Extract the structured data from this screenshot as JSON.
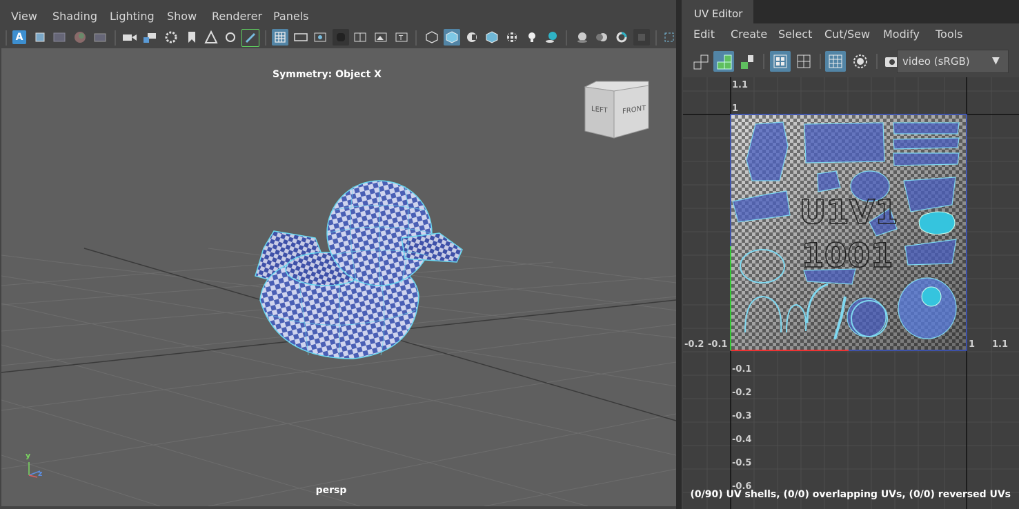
{
  "viewport": {
    "menu": [
      "View",
      "Shading",
      "Lighting",
      "Show",
      "Renderer",
      "Panels"
    ],
    "symmetry_label": "Symmetry: Object X",
    "camera_label": "persp",
    "viewcube": {
      "left": "LEFT",
      "front": "FRONT"
    },
    "axis": {
      "y": "y",
      "z": "z"
    },
    "toolbar_icons": [
      "select-all-icon",
      "frame-icon",
      "grid-toggle-icon",
      "color-icon",
      "film-icon",
      "camera-icon",
      "lock-camera-icon",
      "camera-attr-icon",
      "bookmark-icon",
      "image-plane-icon",
      "2d-pan-icon",
      "grease-pencil-icon",
      "grid-icon",
      "film-gate-icon",
      "resolution-gate-icon",
      "gate-mask-icon",
      "field-chart-icon",
      "safe-action-icon",
      "safe-title-icon",
      "wireframe-icon",
      "smooth-shade-icon",
      "shade-options-icon",
      "wireframe-on-shaded-icon",
      "textured-icon",
      "lights-icon",
      "shadows-icon",
      "ambient-occlusion-icon",
      "motion-blur-icon",
      "anti-alias-icon",
      "isolate-select-icon",
      "xray-icon"
    ]
  },
  "uv_editor": {
    "tab_title": "UV Editor",
    "menu": [
      "Edit",
      "Create",
      "Select",
      "Cut/Sew",
      "Modify",
      "Tools"
    ],
    "color_space": "video (sRGB)",
    "tile_label_line1": "U1V1",
    "tile_label_line2": "1001",
    "axis_labels_top": [
      "1.1",
      "1"
    ],
    "axis_labels_left": [
      "-0.2",
      "-0.1"
    ],
    "axis_labels_right": [
      "1",
      "1.1"
    ],
    "axis_labels_bottom": [
      "-0.1",
      "-0.2",
      "-0.3",
      "-0.4",
      "-0.5",
      "-0.6"
    ],
    "status": "(0/90) UV shells, (0/0) overlapping UVs, (0/0) reversed UVs"
  },
  "colors": {
    "accent": "#5285a6",
    "uv_cyan": "#35c4de",
    "checker_blue": "#4a5fb5"
  }
}
